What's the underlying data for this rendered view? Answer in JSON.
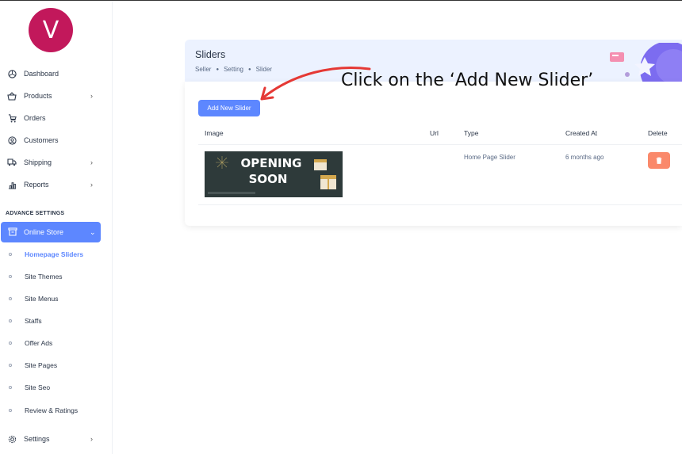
{
  "sidebar": {
    "avatar_letter": "V",
    "nav": [
      {
        "label": "Dashboard",
        "icon": "dashboard-icon"
      },
      {
        "label": "Products",
        "icon": "basket-icon",
        "chevron": "›"
      },
      {
        "label": "Orders",
        "icon": "cart-icon"
      },
      {
        "label": "Customers",
        "icon": "user-circle-icon"
      },
      {
        "label": "Shipping",
        "icon": "truck-icon",
        "chevron": "›"
      },
      {
        "label": "Reports",
        "icon": "chart-icon",
        "chevron": "›"
      }
    ],
    "section_label": "ADVANCE SETTINGS",
    "online_store": {
      "label": "Online Store",
      "chevron": "⌄"
    },
    "sub_items": [
      {
        "label": "Homepage Sliders",
        "active": true
      },
      {
        "label": "Site Themes"
      },
      {
        "label": "Site Menus"
      },
      {
        "label": "Staffs"
      },
      {
        "label": "Offer Ads"
      },
      {
        "label": "Site Pages"
      },
      {
        "label": "Site Seo"
      },
      {
        "label": "Review & Ratings"
      }
    ],
    "settings": {
      "label": "Settings",
      "chevron": "›"
    }
  },
  "header": {
    "title": "Sliders",
    "breadcrumb": [
      "Seller",
      "Setting",
      "Slider"
    ]
  },
  "toolbar": {
    "add_label": "Add New Slider"
  },
  "table": {
    "columns": [
      "Image",
      "Url",
      "Type",
      "Created At",
      "Delete"
    ],
    "rows": [
      {
        "image_text_1": "OPENING",
        "image_text_2": "SOON",
        "url": "",
        "type": "Home Page Slider",
        "created_at": "6 months ago"
      }
    ]
  },
  "annotation": "Click on the ‘Add New Slider’",
  "colors": {
    "accent": "#5d87ff",
    "delete": "#fa896b",
    "avatar": "#c2185b",
    "header_bg": "#ecf2ff",
    "arrow": "#e53935"
  }
}
